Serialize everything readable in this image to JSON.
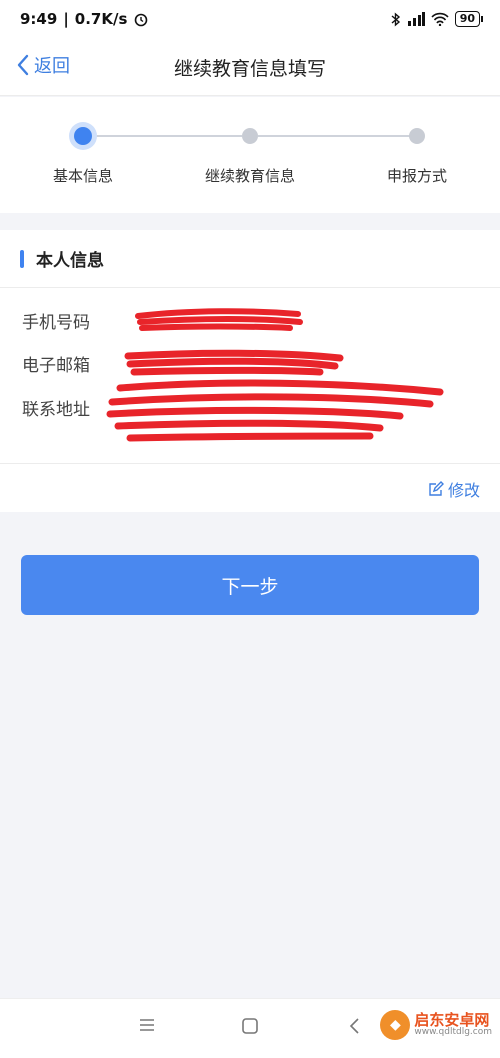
{
  "status": {
    "time": "9:49",
    "speed": "0.7K/s",
    "battery": "90"
  },
  "nav": {
    "back_label": "返回",
    "title": "继续教育信息填写"
  },
  "steps": [
    {
      "label": "基本信息",
      "active": true
    },
    {
      "label": "继续教育信息",
      "active": false
    },
    {
      "label": "申报方式",
      "active": false
    }
  ],
  "section": {
    "title": "本人信息",
    "fields": [
      {
        "label": "手机号码"
      },
      {
        "label": "电子邮箱"
      },
      {
        "label": "联系地址"
      }
    ],
    "edit_label": "修改"
  },
  "next_button": "下一步",
  "watermark": {
    "name": "启东安卓网",
    "url": "www.qdltdlg.com"
  },
  "colors": {
    "accent": "#4a88ef",
    "redaction": "#e8242a"
  }
}
